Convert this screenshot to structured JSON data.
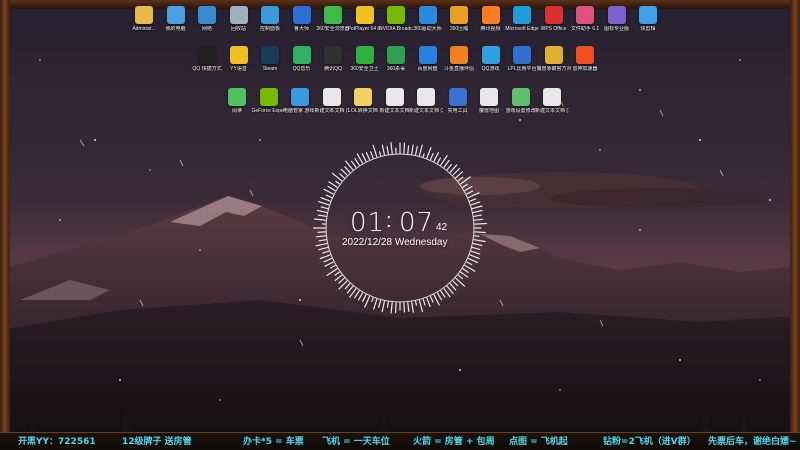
{
  "colors": {
    "ticker": "#4fd8ee",
    "sky_top": "#2b2230",
    "mountain": "#3b2630"
  },
  "desktop": {
    "row1": [
      {
        "label": "Administ...",
        "icon": "user-folder-icon",
        "color": "#e8b84a"
      },
      {
        "label": "我的电脑",
        "icon": "computer-icon",
        "color": "#4aa0e0"
      },
      {
        "label": "网络",
        "icon": "network-icon",
        "color": "#3a8ad0"
      },
      {
        "label": "回收站",
        "icon": "recycle-bin-icon",
        "color": "#9fb0c0"
      },
      {
        "label": "控制面板",
        "icon": "control-panel-icon",
        "color": "#3c9ad8"
      },
      {
        "label": "鲁大师",
        "icon": "ludashi-icon",
        "color": "#2d6fd0"
      },
      {
        "label": "360安全浏览器",
        "icon": "browser-360-icon",
        "color": "#3dba4a"
      },
      {
        "label": "PotPlayer 64 bit",
        "icon": "potplayer-icon",
        "color": "#f0c020"
      },
      {
        "label": "NVIDIA Broadcast",
        "icon": "nvidia-icon",
        "color": "#76b900"
      },
      {
        "label": "360驱动大师",
        "icon": "driver-360-icon",
        "color": "#2a8be0"
      },
      {
        "label": "360压缩",
        "icon": "zip-360-icon",
        "color": "#e8a020"
      },
      {
        "label": "腾讯视频",
        "icon": "tencent-video-icon",
        "color": "#ff7a20"
      },
      {
        "label": "Microsoft Edge",
        "icon": "edge-icon",
        "color": "#1f9fd9"
      },
      {
        "label": "WPS Office",
        "icon": "wps-icon",
        "color": "#d93030"
      },
      {
        "label": "文件助手 6.1",
        "icon": "file-assistant-icon",
        "color": "#e05080"
      },
      {
        "label": "图标专业版",
        "icon": "app-icon",
        "color": "#8060d0"
      },
      {
        "label": "快剪辑",
        "icon": "video-edit-icon",
        "color": "#40a0e8"
      }
    ],
    "row2": [
      {
        "label": "QQ 快捷方式",
        "icon": "qq-icon",
        "color": "#202020"
      },
      {
        "label": "YY语音",
        "icon": "yy-icon",
        "color": "#f0c020"
      },
      {
        "label": "Steam",
        "icon": "steam-icon",
        "color": "#1b3a5a"
      },
      {
        "label": "QQ音乐",
        "icon": "qq-music-icon",
        "color": "#30b060"
      },
      {
        "label": "腾讯QQ",
        "icon": "tencent-qq-icon",
        "color": "#303030"
      },
      {
        "label": "360安全卫士",
        "icon": "security-360-icon",
        "color": "#30b040"
      },
      {
        "label": "360杀毒",
        "icon": "antivirus-360-icon",
        "color": "#30a050"
      },
      {
        "label": "百度网盘",
        "icon": "baidu-pan-icon",
        "color": "#2a80e0"
      },
      {
        "label": "斗鱼直播伴侣",
        "icon": "douyu-icon",
        "color": "#f08020"
      },
      {
        "label": "QQ游戏",
        "icon": "qq-game-icon",
        "color": "#30a0e0"
      },
      {
        "label": "LPL比赛平台",
        "icon": "lpl-icon",
        "color": "#3070d0"
      },
      {
        "label": "魔兽争霸官方对战平台",
        "icon": "warcraft-icon",
        "color": "#e0b030"
      },
      {
        "label": "雷神加速器",
        "icon": "accelerator-icon",
        "color": "#f05020"
      }
    ],
    "row3": [
      {
        "label": "阅读",
        "icon": "document-icon",
        "color": "#50c060"
      },
      {
        "label": "GeForce Experience",
        "icon": "geforce-icon",
        "color": "#76b900"
      },
      {
        "label": "电脑管家 游戏平台",
        "icon": "pc-manager-icon",
        "color": "#3a9ae0"
      },
      {
        "label": "新建文本文档 (2)",
        "icon": "text-file-icon",
        "color": "#e8e8e8"
      },
      {
        "label": "LOL转换文档",
        "icon": "folder-icon",
        "color": "#f0d060"
      },
      {
        "label": "新建文本文档",
        "icon": "text-file-icon",
        "color": "#e8e8e8"
      },
      {
        "label": "新建文本文档 (3)",
        "icon": "text-file-icon",
        "color": "#e8e8e8"
      },
      {
        "label": "实用工具",
        "icon": "tools-icon",
        "color": "#3a70d0"
      },
      {
        "label": "魔兽地图",
        "icon": "text-file-icon",
        "color": "#e8e8e8"
      },
      {
        "label": "游戏设置修改",
        "icon": "document-icon",
        "color": "#60c070"
      },
      {
        "label": "新建文本文档 (1)",
        "icon": "text-file-icon",
        "color": "#e8e8e8"
      }
    ]
  },
  "clock": {
    "hour": "01",
    "sep": ":",
    "minute": "07",
    "second": "42",
    "date": "2022/12/28 Wednesday"
  },
  "ticker": [
    {
      "text": "开黑YY：722561"
    },
    {
      "text": "12级牌子 送房管"
    },
    {
      "text": "办卡*5 = 车票"
    },
    {
      "text": "飞机 = 一天车位"
    },
    {
      "text": "火箭 = 房管 + 包周"
    },
    {
      "text": "点图 = 飞机起"
    },
    {
      "text": "钻粉=2飞机（进V群）"
    },
    {
      "text": "先票后车，谢绝白嫖~"
    }
  ]
}
